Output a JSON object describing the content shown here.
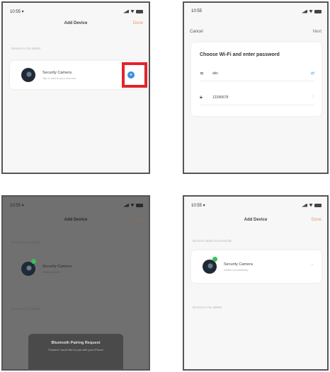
{
  "panel1": {
    "status": {
      "time": "10:55 ▾"
    },
    "nav": {
      "title": "Add Device",
      "right": "Done"
    },
    "section_label": "Devices to be added",
    "device": {
      "name": "Security Camera",
      "sub": "Tap to add to your account",
      "add_symbol": "+"
    }
  },
  "panel2": {
    "status": {
      "time": "10:55"
    },
    "nav": {
      "left": "Cancel",
      "right": "Next"
    },
    "heading": "Choose Wi-Fi and enter password",
    "rows": [
      {
        "icon": "wifi-icon",
        "text": "abc",
        "action": "⇄"
      },
      {
        "icon": "lock-icon",
        "text": "12345678",
        "action": "◌"
      }
    ]
  },
  "panel3": {
    "status": {
      "time": "10:55 ▾"
    },
    "nav": {
      "title": "Add Device",
      "right": "Done"
    },
    "section_label": "Devices to be added",
    "device": {
      "name": "Security Camera",
      "sub": "Adding device..."
    },
    "section_label_2": "Devices to be added",
    "toast": {
      "title": "Bluetooth Pairing Request",
      "body": "\"Camera\" would like to pair with your iPhone."
    }
  },
  "panel4": {
    "status": {
      "time": "10:55 ▾"
    },
    "nav": {
      "title": "Add Device",
      "right": "Done"
    },
    "section_label": "Devices added successfully",
    "device": {
      "name": "Security Camera",
      "sub": "Added successfully",
      "chevron": "›"
    },
    "section_label_2": "Devices to be added"
  },
  "colors": {
    "accent": "#e89a6a",
    "highlight": "#e3232b",
    "add_button": "#3b8de0",
    "online_dot": "#3bbf5a"
  }
}
